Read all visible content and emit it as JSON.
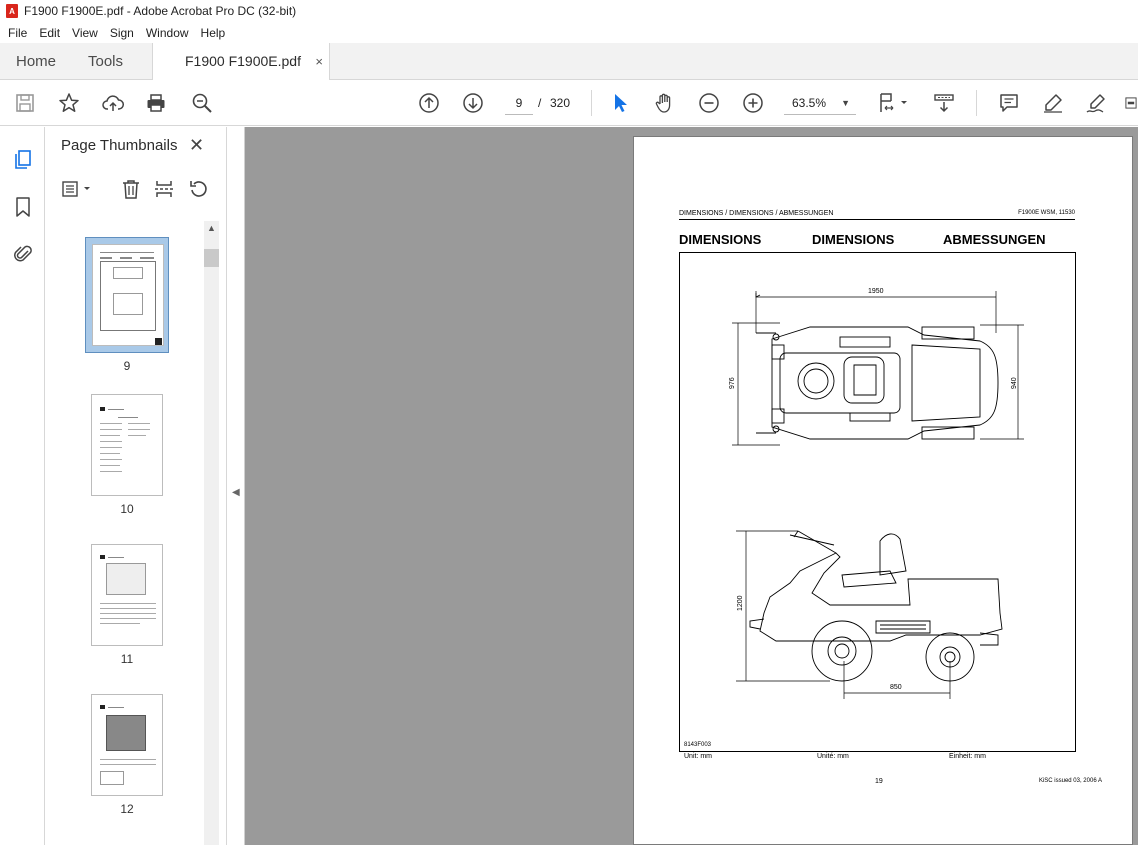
{
  "window": {
    "title": "F1900 F1900E.pdf - Adobe Acrobat Pro DC (32-bit)"
  },
  "menu": [
    "File",
    "Edit",
    "View",
    "Sign",
    "Window",
    "Help"
  ],
  "tabs": {
    "home": "Home",
    "tools": "Tools",
    "document": "F1900 F1900E.pdf",
    "close_symbol": "×"
  },
  "toolbar": {
    "page_current": "9",
    "page_separator": "/",
    "page_total": "320",
    "zoom": "63.5%"
  },
  "panel": {
    "title": "Page Thumbnails",
    "close_symbol": "✕",
    "thumbnails": [
      {
        "label": "9",
        "selected": true
      },
      {
        "label": "10",
        "selected": false
      },
      {
        "label": "11",
        "selected": false
      },
      {
        "label": "12",
        "selected": false
      }
    ]
  },
  "document": {
    "header_left": "DIMENSIONS / DIMENSIONS / ABMESSUNGEN",
    "header_right": "F1900E  WSM, 11530",
    "headings": [
      "DIMENSIONS",
      "DIMENSIONS",
      "ABMESSUNGEN"
    ],
    "dims": {
      "width": "1950",
      "length_left": "976",
      "length_right": "940",
      "height": "1200",
      "wheelbase": "850"
    },
    "drawing_code": "8143F003",
    "units": [
      "Unit: mm",
      "Unité: mm",
      "Einheit: mm"
    ],
    "page_number": "19",
    "issue": "KiSC issued 03, 2006 A"
  },
  "colors": {
    "accent_blue": "#1473e6",
    "viewer_gray": "#9a9a9a",
    "selection_blue": "#a9c9e8",
    "pdf_red": "#d9261c"
  }
}
